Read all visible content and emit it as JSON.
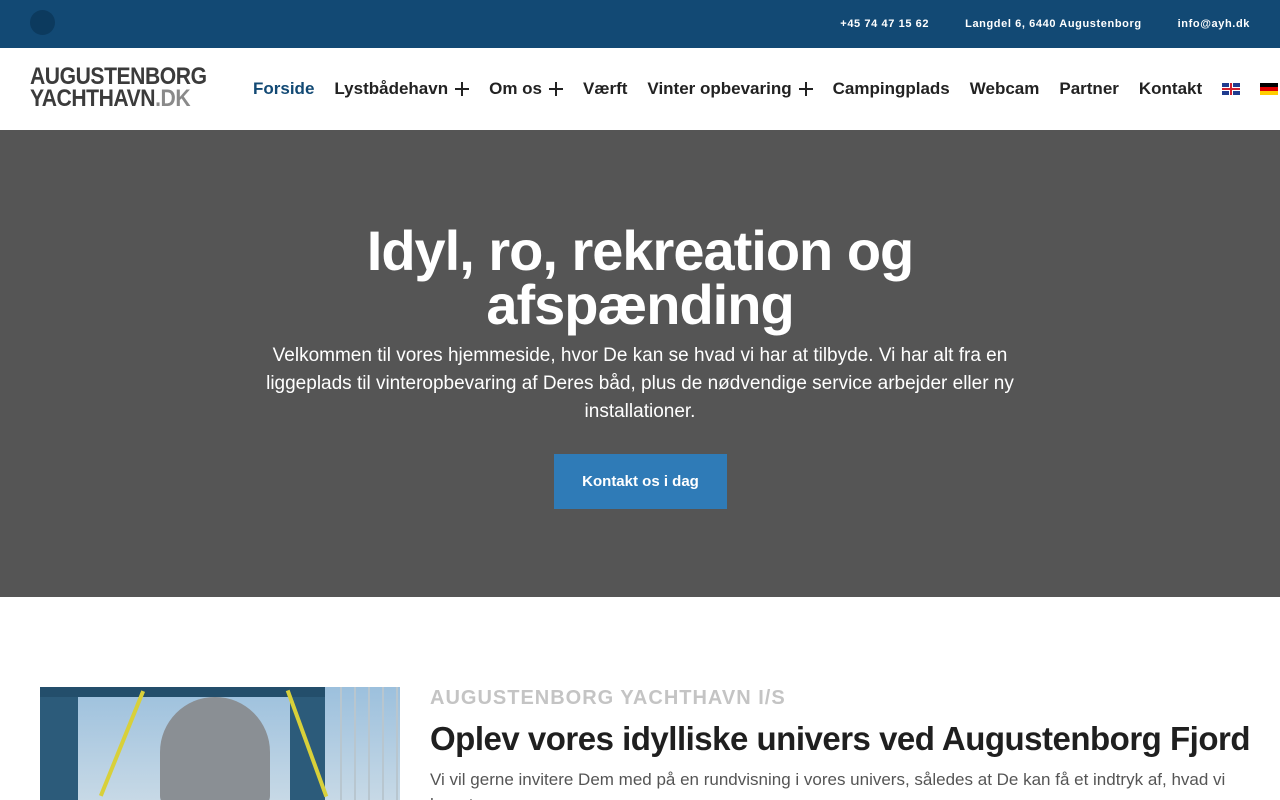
{
  "topbar": {
    "phone": "+45 74 47 15 62",
    "address": "Langdel 6, 6440 Augustenborg",
    "email": "info@ayh.dk"
  },
  "logo": {
    "line1": "AUGUSTENBORG",
    "line2": "YACHTHAVN",
    "line2_suffix": ".DK"
  },
  "nav": {
    "items": [
      {
        "label": "Forside",
        "active": true,
        "submenu": false
      },
      {
        "label": "Lystbådehavn",
        "submenu": true
      },
      {
        "label": "Om os",
        "submenu": true
      },
      {
        "label": "Værft",
        "submenu": false
      },
      {
        "label": "Vinter opbevaring",
        "submenu": true
      },
      {
        "label": "Campingplads",
        "submenu": false
      },
      {
        "label": "Webcam",
        "submenu": false
      },
      {
        "label": "Partner",
        "submenu": false
      },
      {
        "label": "Kontakt",
        "submenu": false
      }
    ],
    "languages": [
      "english-flag-icon",
      "german-flag-icon"
    ]
  },
  "hero": {
    "title": "Idyl, ro, rekreation og afspænding",
    "text": "Velkommen til vores hjemmeside, hvor De kan se hvad vi har at tilbyde. Vi har alt fra en liggeplads til vinteropbevaring af Deres båd, plus de nødvendige service arbejder eller ny installationer.",
    "cta_label": "Kontakt os i dag"
  },
  "about": {
    "eyebrow": "AUGUSTENBORG YACHTHAVN I/S",
    "title": "Oplev vores idylliske univers ved Augustenborg Fjord",
    "text": "Vi vil gerne invitere Dem med på en rundvisning i vores univers, således at De kan få et indtryk af, hvad vi har at"
  },
  "colors": {
    "topbar": "#124974",
    "accent": "#124974",
    "hero_bg": "#555555",
    "cta_bg": "#2f7bb7"
  }
}
